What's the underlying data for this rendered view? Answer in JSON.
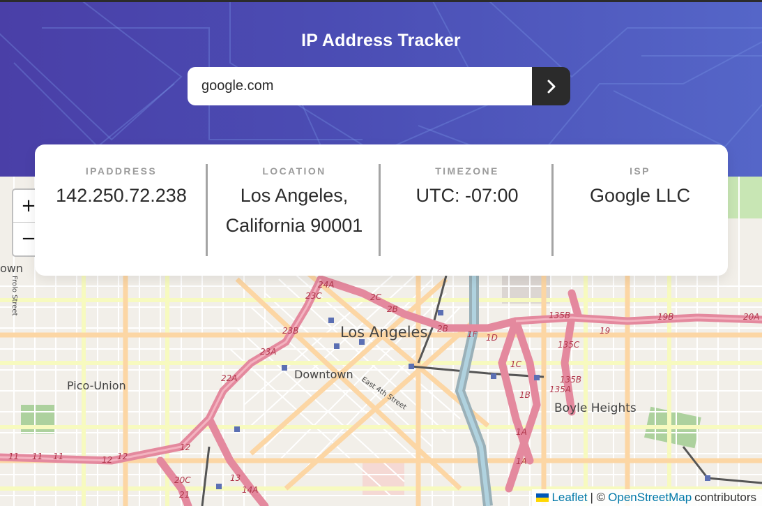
{
  "header": {
    "title": "IP Address Tracker",
    "search_value": "google.com",
    "submit_icon": "chevron-right-icon"
  },
  "info": [
    {
      "label": "IPADDRESS",
      "value": "142.250.72.238"
    },
    {
      "label": "LOCATION",
      "value": "Los Angeles, California 90001"
    },
    {
      "label": "TIMEZONE",
      "value": "UTC: -07:00"
    },
    {
      "label": "ISP",
      "value": "Google LLC"
    }
  ],
  "map": {
    "zoom_in_label": "+",
    "zoom_out_label": "−",
    "place_labels": {
      "city": "Los Angeles",
      "downtown": "Downtown",
      "pico_union": "Pico-Union",
      "boyle_heights": "Boyle Heights",
      "east_4th": "East 4th Street",
      "frolo_street": "Frolo Street",
      "town_fragment": "own"
    },
    "road_labels": [
      "24A",
      "23C",
      "2C",
      "2B",
      "23B",
      "2B",
      "1F",
      "1D",
      "135B",
      "19",
      "19B",
      "20A",
      "135C",
      "23A",
      "1C",
      "22A",
      "135B",
      "135A",
      "1B",
      "1A",
      "12",
      "11",
      "11",
      "11",
      "12",
      "12",
      "20C",
      "21",
      "13",
      "14A",
      "1A"
    ],
    "attribution": {
      "leaflet": "Leaflet",
      "separator": "| ©",
      "osm": "OpenStreetMap",
      "contributors": "contributors"
    }
  },
  "colors": {
    "header_start": "#4a3fa7",
    "header_end": "#5566c8",
    "dark": "#2b2b2b",
    "label_gray": "#9b9b9b",
    "motorway": "#e4899e",
    "primary": "#fcd6a4",
    "secondary": "#f7fabf",
    "map_bg": "#f2efe9"
  }
}
